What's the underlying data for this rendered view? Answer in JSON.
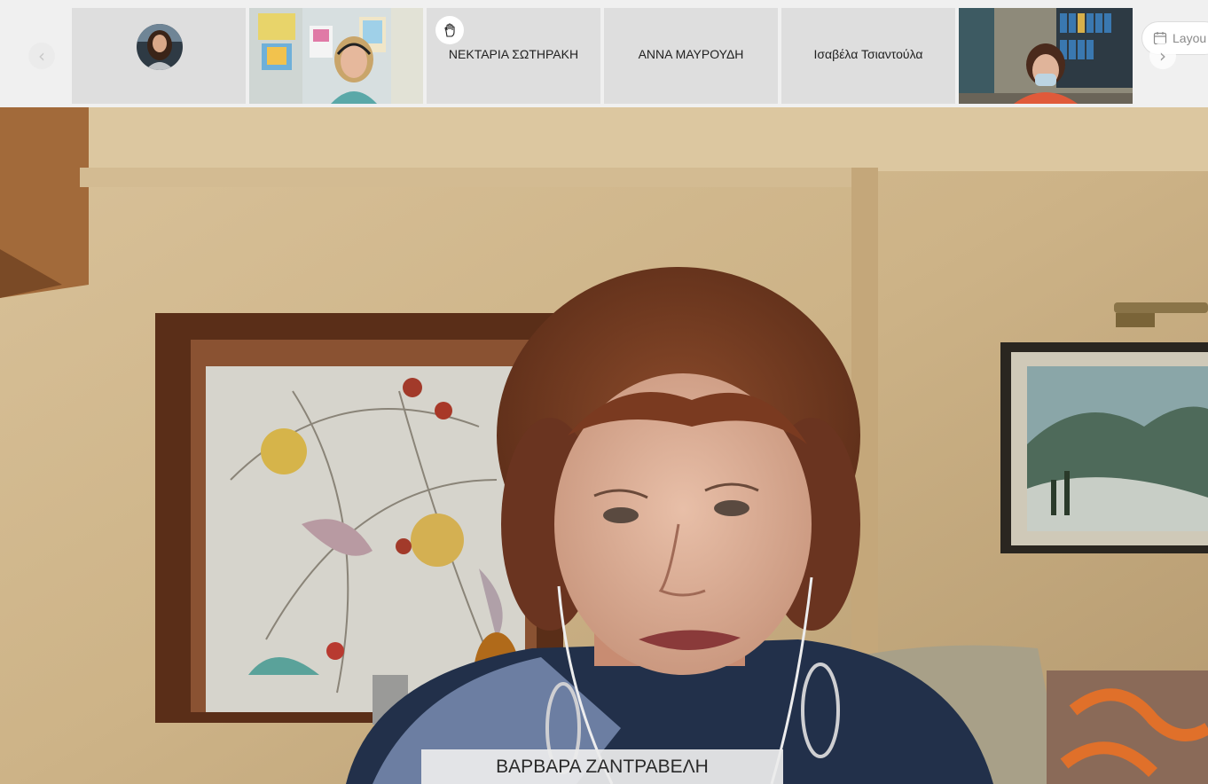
{
  "participants": [
    {
      "type": "avatar"
    },
    {
      "type": "video"
    },
    {
      "type": "name",
      "name": "ΝΕΚΤΑΡΙΑ ΣΩΤΗΡΑΚΗ",
      "hand_raised": true
    },
    {
      "type": "name",
      "name": "ΑΝΝΑ ΜΑΥΡΟΥΔΗ"
    },
    {
      "type": "name",
      "name": "Ισαβέλα Τσιαντούλα"
    },
    {
      "type": "video"
    }
  ],
  "icons": {
    "prev": "chevron-left-icon",
    "next": "chevron-right-icon",
    "hand": "raised-hand-icon",
    "layout": "calendar-layout-icon"
  },
  "layout_button": {
    "label": "Layou"
  },
  "speaker": {
    "name": "ΒΑΡΒΑΡΑ ΖΑΝΤΡΑΒΕΛΗ"
  },
  "colors": {
    "strip_background": "#f0f0f0",
    "tile_background": "#dedede",
    "name_plate_background": "#ececec"
  }
}
